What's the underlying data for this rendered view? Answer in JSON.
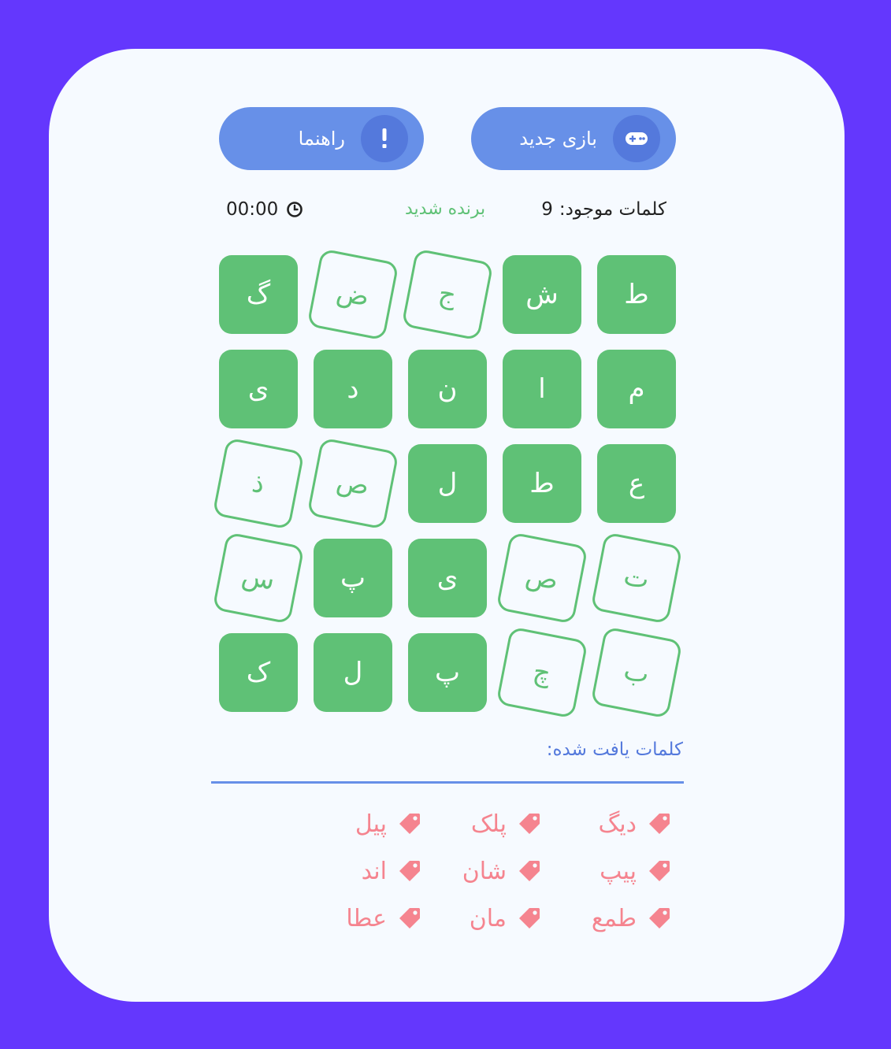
{
  "toolbar": {
    "new_game_label": "بازی جدید",
    "help_label": "راهنما"
  },
  "status": {
    "found_label": "کلمات موجود:",
    "found_count": "9",
    "result": "برنده شدید",
    "timer": "00:00"
  },
  "board": {
    "rows": [
      [
        {
          "letter": "ط",
          "selected": true
        },
        {
          "letter": "ش",
          "selected": true
        },
        {
          "letter": "ج",
          "selected": false
        },
        {
          "letter": "ض",
          "selected": false
        },
        {
          "letter": "گ",
          "selected": true
        }
      ],
      [
        {
          "letter": "م",
          "selected": true
        },
        {
          "letter": "ا",
          "selected": true
        },
        {
          "letter": "ن",
          "selected": true
        },
        {
          "letter": "د",
          "selected": true
        },
        {
          "letter": "ی",
          "selected": true
        }
      ],
      [
        {
          "letter": "ع",
          "selected": true
        },
        {
          "letter": "ط",
          "selected": true
        },
        {
          "letter": "ل",
          "selected": true
        },
        {
          "letter": "ص",
          "selected": false
        },
        {
          "letter": "ذ",
          "selected": false
        }
      ],
      [
        {
          "letter": "ت",
          "selected": false
        },
        {
          "letter": "ص",
          "selected": false
        },
        {
          "letter": "ی",
          "selected": true
        },
        {
          "letter": "پ",
          "selected": true
        },
        {
          "letter": "س",
          "selected": false
        }
      ],
      [
        {
          "letter": "ب",
          "selected": false
        },
        {
          "letter": "چ",
          "selected": false
        },
        {
          "letter": "پ",
          "selected": true
        },
        {
          "letter": "ل",
          "selected": true
        },
        {
          "letter": "ک",
          "selected": true
        }
      ]
    ]
  },
  "found_words": {
    "title": "کلمات یافت شده:",
    "items": [
      {
        "word": "دیگ"
      },
      {
        "word": "پلک"
      },
      {
        "word": "پیل"
      },
      {
        "word": "پیپ"
      },
      {
        "word": "شان"
      },
      {
        "word": "اند"
      },
      {
        "word": "طمع"
      },
      {
        "word": "مان"
      },
      {
        "word": "عطا"
      }
    ]
  },
  "colors": {
    "background": "#6437fd",
    "card": "#f6faff",
    "button": "#6790e8",
    "button_circle": "#5479dc",
    "tile_green": "#5fc176",
    "word_pink": "#f5848f",
    "heading_blue": "#5479dc"
  },
  "icons": {
    "new_game": "gamepad-icon",
    "help": "exclamation-icon",
    "timer": "clock-icon",
    "word": "tag-icon"
  }
}
